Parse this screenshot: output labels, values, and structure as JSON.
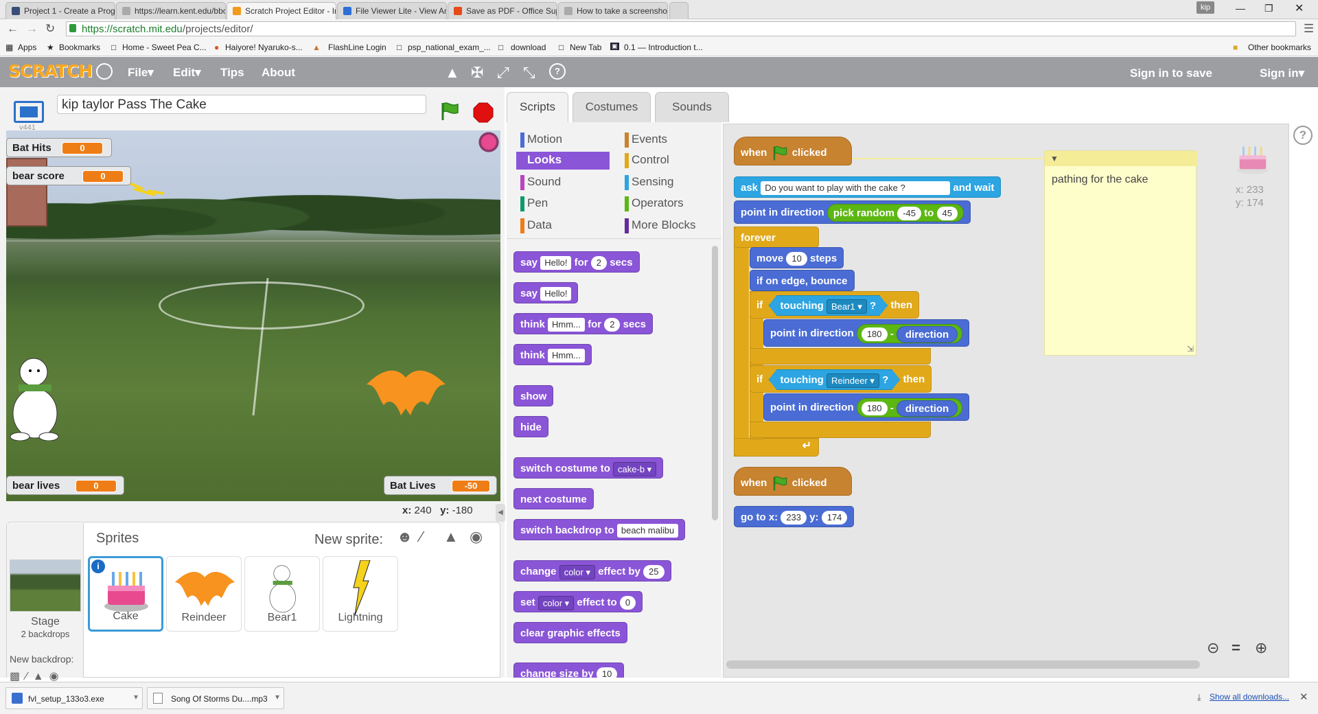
{
  "browser": {
    "tabs": [
      {
        "label": "Project 1 - Create a Progra",
        "color": "#3a4d7a"
      },
      {
        "label": "https://learn.kent.edu/bbc",
        "color": "#888888"
      },
      {
        "label": "Scratch Project Editor - Im",
        "color": "#f29a1a"
      },
      {
        "label": "File Viewer Lite - View Any",
        "color": "#2d6fd6"
      },
      {
        "label": "Save as PDF - Office Suppo",
        "color": "#e64a19"
      },
      {
        "label": "How to take a screenshot",
        "color": "#888888"
      }
    ],
    "profile": "kip",
    "url_host": "https://scratch.mit.edu",
    "url_path": "/projects/editor/",
    "bookmarks": [
      "Apps",
      "Bookmarks",
      "Home - Sweet Pea C...",
      "Haiyore! Nyaruko-s...",
      "FlashLine Login",
      "psp_national_exam_...",
      "download",
      "New Tab",
      "0.1 — Introduction t..."
    ],
    "other_bookmarks": "Other bookmarks"
  },
  "scratch": {
    "logo": "SCRATCH",
    "menu": [
      "File▾",
      "Edit▾",
      "Tips",
      "About"
    ],
    "sign_in_save": "Sign in to save",
    "sign_in": "Sign in▾",
    "project_title": "kip taylor Pass The Cake",
    "version": "v441",
    "monitors": {
      "bat_hits": {
        "label": "Bat Hits",
        "value": "0"
      },
      "bear_score": {
        "label": "bear score",
        "value": "0"
      },
      "bear_lives": {
        "label": "bear lives",
        "value": "0"
      },
      "bat_lives": {
        "label": "Bat Lives",
        "value": "-50"
      }
    },
    "coords": {
      "x_label": "x:",
      "x": "240",
      "y_label": "y:",
      "y": "-180"
    },
    "sprites_header": "Sprites",
    "new_sprite": "New sprite:",
    "stage_label": "Stage",
    "stage_backdrops": "2 backdrops",
    "new_backdrop": "New backdrop:",
    "sprites": [
      "Cake",
      "Reindeer",
      "Bear1",
      "Lightning"
    ],
    "tabs": [
      "Scripts",
      "Costumes",
      "Sounds"
    ],
    "categories_left": [
      "Motion",
      "Looks",
      "Sound",
      "Pen",
      "Data"
    ],
    "categories_right": [
      "Events",
      "Control",
      "Sensing",
      "Operators",
      "More Blocks"
    ],
    "category_colors": {
      "Motion": "#4a6cd4",
      "Looks": "#8a55d7",
      "Sound": "#bb42c3",
      "Pen": "#0e9a6c",
      "Data": "#ee7d16",
      "Events": "#c88330",
      "Control": "#e1a91a",
      "Sensing": "#2ca5e2",
      "Operators": "#5cb712",
      "More Blocks": "#632d99"
    },
    "palette": {
      "say_for": {
        "a": "say",
        "b": "Hello!",
        "c": "for",
        "d": "2",
        "e": "secs"
      },
      "say": {
        "a": "say",
        "b": "Hello!"
      },
      "think_for": {
        "a": "think",
        "b": "Hmm...",
        "c": "for",
        "d": "2",
        "e": "secs"
      },
      "think": {
        "a": "think",
        "b": "Hmm..."
      },
      "show": "show",
      "hide": "hide",
      "switch_costume": {
        "a": "switch costume to",
        "b": "cake-b"
      },
      "next_costume": "next costume",
      "switch_backdrop": {
        "a": "switch backdrop to",
        "b": "beach malibu"
      },
      "change_effect": {
        "a": "change",
        "b": "color",
        "c": "effect by",
        "d": "25"
      },
      "set_effect": {
        "a": "set",
        "b": "color",
        "c": "effect to",
        "d": "0"
      },
      "clear_effects": "clear graphic effects",
      "change_size": {
        "a": "change size by",
        "b": "10"
      }
    },
    "script1": {
      "hat": {
        "a": "when",
        "b": "clicked"
      },
      "ask": {
        "a": "ask",
        "b": "Do you want to play with the cake ?",
        "c": "and wait"
      },
      "point_random": {
        "a": "point in direction",
        "b": "pick random",
        "c": "-45",
        "d": "to",
        "e": "45"
      },
      "forever": "forever",
      "move": {
        "a": "move",
        "b": "10",
        "c": "steps"
      },
      "bounce": "if on edge, bounce",
      "if1": {
        "a": "if",
        "b": "touching",
        "c": "Bear1",
        "d": "?",
        "e": "then"
      },
      "point1": {
        "a": "point in direction",
        "b": "180",
        "c": "-",
        "d": "direction"
      },
      "if2": {
        "a": "if",
        "b": "touching",
        "c": "Reindeer",
        "d": "?",
        "e": "then"
      },
      "point2": {
        "a": "point in direction",
        "b": "180",
        "c": "-",
        "d": "direction"
      }
    },
    "script2": {
      "hat": {
        "a": "when",
        "b": "clicked"
      },
      "goto": {
        "a": "go to x:",
        "b": "233",
        "c": "y:",
        "d": "174"
      }
    },
    "comment": "pathing for the cake",
    "sprite_pos": {
      "x": "x: 233",
      "y": "y: 174"
    }
  },
  "downloads": {
    "items": [
      "fvl_setup_133o3.exe",
      "Song Of Storms Du....mp3"
    ],
    "show_all": "Show all downloads..."
  }
}
